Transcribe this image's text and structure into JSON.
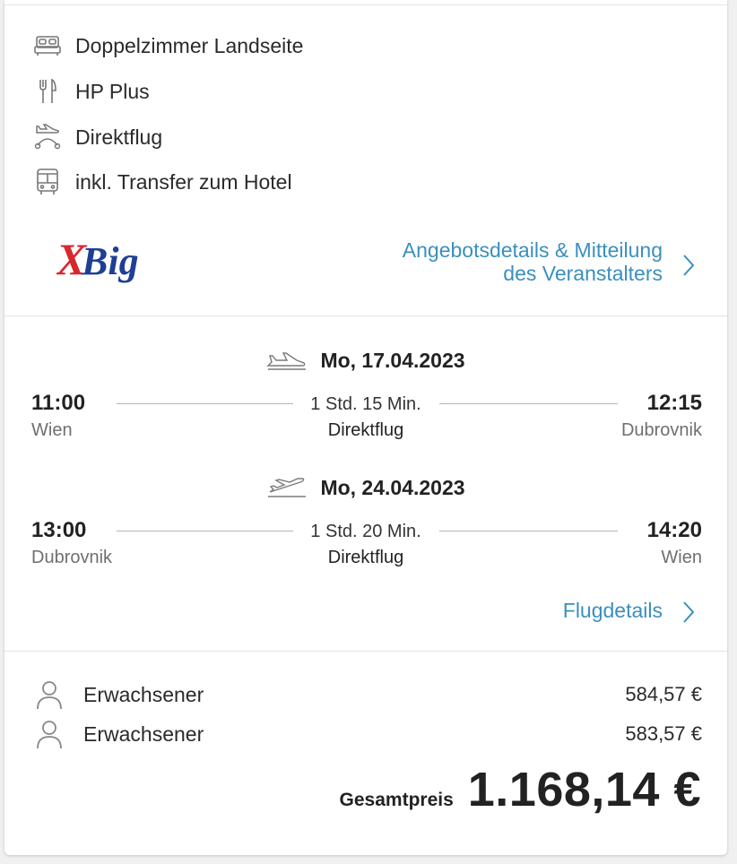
{
  "features": [
    {
      "icon": "bed-icon",
      "label": "Doppelzimmer Landseite"
    },
    {
      "icon": "cutlery-icon",
      "label": "HP Plus"
    },
    {
      "icon": "direct-flight-icon",
      "label": "Direktflug"
    },
    {
      "icon": "bus-icon",
      "label": "inkl. Transfer zum Hotel"
    }
  ],
  "operator": {
    "logo_text": "XBig",
    "details_link_line1": "Angebotsdetails & Mitteilung",
    "details_link_line2": "des Veranstalters"
  },
  "outbound": {
    "date": "Mo, 17.04.2023",
    "dep_time": "11:00",
    "dep_city": "Wien",
    "duration": "1 Std. 15 Min.",
    "type": "Direktflug",
    "arr_time": "12:15",
    "arr_city": "Dubrovnik"
  },
  "inbound": {
    "date": "Mo, 24.04.2023",
    "dep_time": "13:00",
    "dep_city": "Dubrovnik",
    "duration": "1 Std. 20 Min.",
    "type": "Direktflug",
    "arr_time": "14:20",
    "arr_city": "Wien"
  },
  "flight_details_link": "Flugdetails",
  "passengers": [
    {
      "label": "Erwachsener",
      "price": "584,57 €"
    },
    {
      "label": "Erwachsener",
      "price": "583,57 €"
    }
  ],
  "total": {
    "label": "Gesamtpreis",
    "value": "1.168,14 €"
  },
  "colors": {
    "link": "#3a8fbf",
    "logo_red": "#d8272d",
    "logo_blue": "#1f3f95"
  }
}
